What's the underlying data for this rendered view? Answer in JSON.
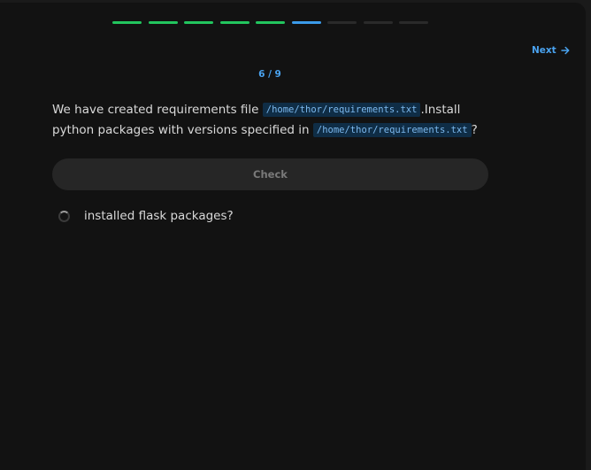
{
  "progress": {
    "total": 9,
    "current": 6,
    "colors": {
      "done": "#22c55e",
      "current": "#3b9bea",
      "pending": "#2a2a2a"
    }
  },
  "nav": {
    "next_label": "Next"
  },
  "question": {
    "counter": "6 / 9",
    "text_part1": "We have created requirements file ",
    "code_path1": "/home/thor/requirements.txt",
    "text_part2": ".Install python packages with versions specified in ",
    "code_path2": "/home/thor/requirements.txt",
    "text_part3": "?"
  },
  "actions": {
    "check_label": "Check"
  },
  "tasks": [
    {
      "label": "installed flask packages?",
      "icon": "loading-spinner-icon"
    }
  ]
}
